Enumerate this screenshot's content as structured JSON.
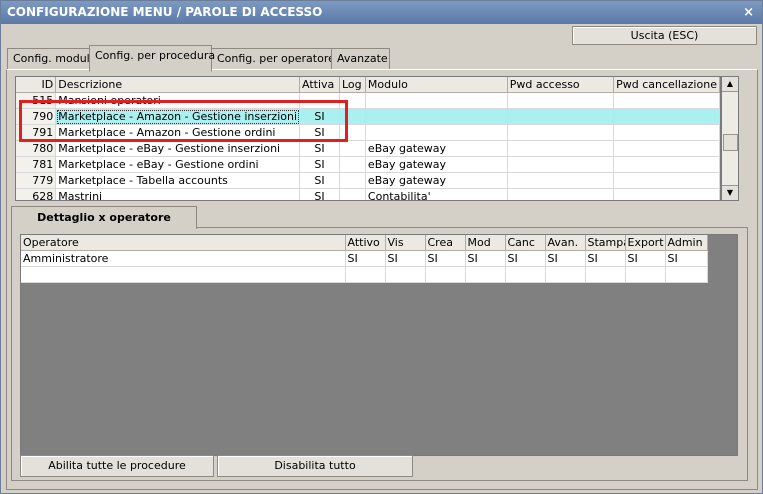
{
  "window": {
    "title": "CONFIGURAZIONE MENU / PAROLE DI ACCESSO",
    "close_glyph": "×"
  },
  "buttons": {
    "exit": "Uscita (ESC)",
    "enable_all": "Abilita tutte le procedure",
    "disable_all": "Disabilita tutto"
  },
  "tabs": [
    "Config. moduli",
    "Config. per procedura",
    "Config. per operatore",
    "Avanzate"
  ],
  "active_tab": "Config. per procedura",
  "grid": {
    "columns": [
      "ID",
      "Descrizione",
      "Attiva",
      "Log",
      "Modulo",
      "Pwd accesso",
      "Pwd cancellazione"
    ],
    "rows": [
      [
        "515",
        "Mansioni operatori",
        "",
        "",
        "",
        "",
        ""
      ],
      [
        "790",
        "Marketplace - Amazon - Gestione inserzioni",
        "SI",
        "",
        "",
        "",
        ""
      ],
      [
        "791",
        "Marketplace - Amazon - Gestione ordini",
        "SI",
        "",
        "",
        "",
        ""
      ],
      [
        "780",
        "Marketplace - eBay - Gestione inserzioni",
        "SI",
        "",
        "eBay gateway",
        "",
        ""
      ],
      [
        "781",
        "Marketplace - eBay - Gestione ordini",
        "SI",
        "",
        "eBay gateway",
        "",
        ""
      ],
      [
        "779",
        "Marketplace - Tabella accounts",
        "SI",
        "",
        "eBay gateway",
        "",
        ""
      ],
      [
        "628",
        "Mastrini",
        "SI",
        "",
        "Contabilita'",
        "",
        ""
      ]
    ],
    "selected_row_id": "790",
    "highlighted_ids": [
      "790",
      "791"
    ]
  },
  "detail": {
    "tab_label": "Dettaglio x operatore",
    "columns": [
      "Operatore",
      "Attivo",
      "Vis",
      "Crea",
      "Mod",
      "Canc",
      "Avan.",
      "Stampa",
      "Export",
      "Admin"
    ],
    "rows": [
      [
        "Amministratore",
        "SI",
        "SI",
        "SI",
        "SI",
        "SI",
        "SI",
        "SI",
        "SI",
        "SI"
      ],
      [
        "",
        "",
        "",
        "",
        "",
        "",
        "",
        "",
        "",
        ""
      ]
    ]
  },
  "scroll_icons": {
    "up": "scroll-up-arrow-icon",
    "down": "scroll-down-arrow-icon"
  },
  "colors": {
    "highlight_row": "#aaf0f0",
    "annotation_box": "#e02020",
    "title_bar": "#6a89b4"
  }
}
